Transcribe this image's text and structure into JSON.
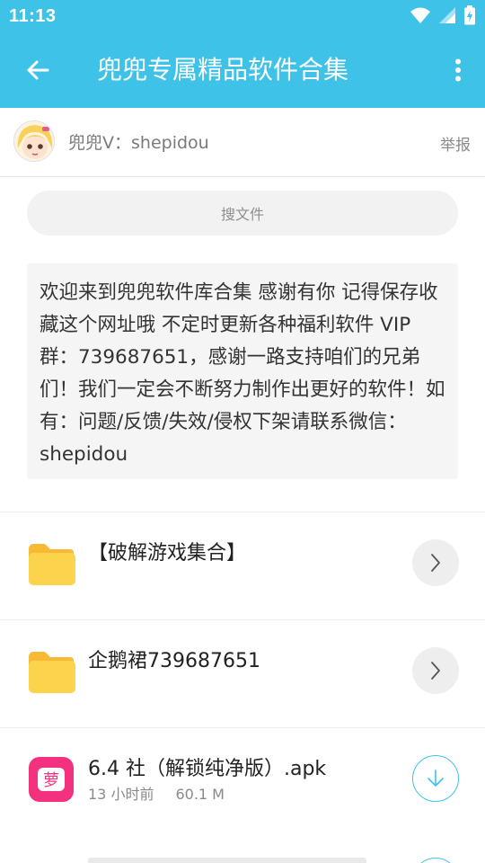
{
  "status_bar": {
    "time": "11:13"
  },
  "app_bar": {
    "title": "兜兜专属精品软件合集"
  },
  "owner": {
    "name": "兜兜V：shepidou",
    "report_label": "举报"
  },
  "search": {
    "placeholder": "搜文件"
  },
  "notice": {
    "text": "欢迎来到兜兜软件库合集 感谢有你 记得保存收藏这个网址哦 不定时更新各种福利软件 VIP群：739687651，感谢一路支持咱们的兄弟们！我们一定会不断努力制作出更好的软件！如有：问题/反馈/失效/侵权下架请联系微信：shepidou"
  },
  "files": [
    {
      "type": "folder",
      "title": "【破解游戏集合】",
      "icon": "folder-icon",
      "action_icon": "chevron-right-icon"
    },
    {
      "type": "folder",
      "title": "企鹅裙739687651",
      "icon": "folder-icon",
      "action_icon": "chevron-right-icon"
    },
    {
      "type": "apk",
      "title": "6.4 社（解锁纯净版）.apk",
      "time": "13 小时前",
      "size": "60.1 M",
      "icon": "app-icon",
      "icon_text": "萝",
      "action_icon": "download-icon"
    }
  ],
  "colors": {
    "accent": "#3fc2e8",
    "folder": "#fcd34d",
    "apk_icon": "#f4317e"
  }
}
